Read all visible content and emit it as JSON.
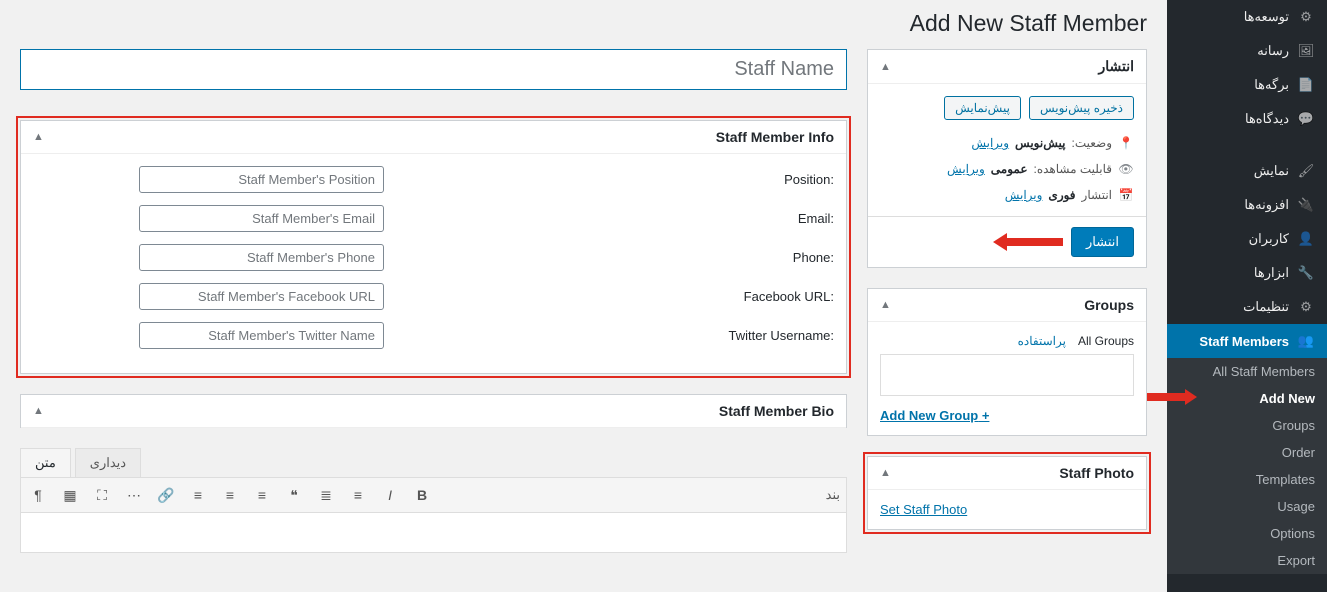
{
  "page": {
    "title": "Add New Staff Member",
    "title_placeholder": "Staff Name"
  },
  "sidebar": {
    "items": [
      {
        "label": "توسعه‌ها",
        "icon": "ext"
      },
      {
        "label": "رسانه",
        "icon": "media"
      },
      {
        "label": "برگه‌ها",
        "icon": "page"
      },
      {
        "label": "دیدگاه‌ها",
        "icon": "comment"
      },
      {
        "label": "نمایش",
        "icon": "appearance"
      },
      {
        "label": "افزونه‌ها",
        "icon": "plugin"
      },
      {
        "label": "کاربران",
        "icon": "user"
      },
      {
        "label": "ابزارها",
        "icon": "tools"
      },
      {
        "label": "تنظیمات",
        "icon": "settings"
      }
    ],
    "current": {
      "label": "Staff Members",
      "icon": "group"
    },
    "submenu": [
      {
        "label": "All Staff Members"
      },
      {
        "label": "Add New",
        "current": true
      },
      {
        "label": "Groups"
      },
      {
        "label": "Order"
      },
      {
        "label": "Templates"
      },
      {
        "label": "Usage"
      },
      {
        "label": "Options"
      },
      {
        "label": "Export"
      }
    ]
  },
  "info_box": {
    "title": "Staff Member Info",
    "fields": [
      {
        "label": "Position:",
        "placeholder": "Staff Member's Position"
      },
      {
        "label": "Email:",
        "placeholder": "Staff Member's Email"
      },
      {
        "label": "Phone:",
        "placeholder": "Staff Member's Phone"
      },
      {
        "label": "Facebook URL:",
        "placeholder": "Staff Member's Facebook URL"
      },
      {
        "label": "Twitter Username:",
        "placeholder": "Staff Member's Twitter Name"
      }
    ]
  },
  "bio_box": {
    "title": "Staff Member Bio",
    "tab_visual": "دیداری",
    "tab_text": "متن",
    "paragraph_label": "بند"
  },
  "publish_box": {
    "title": "انتشار",
    "save_draft": "ذخیره پیش‌نویس",
    "preview": "پیش‌نمایش",
    "status_label": "وضعیت:",
    "status_value": "پیش‌نویس",
    "visibility_label": "قابلیت مشاهده:",
    "visibility_value": "عمومی",
    "schedule_label": "انتشار",
    "schedule_value": "فوری",
    "edit": "ویرایش",
    "publish_btn": "انتشار"
  },
  "groups_box": {
    "title": "Groups",
    "tab_all": "All Groups",
    "tab_used": "پراستفاده",
    "add_link": "+ Add New Group"
  },
  "photo_box": {
    "title": "Staff Photo",
    "link": "Set Staff Photo"
  }
}
